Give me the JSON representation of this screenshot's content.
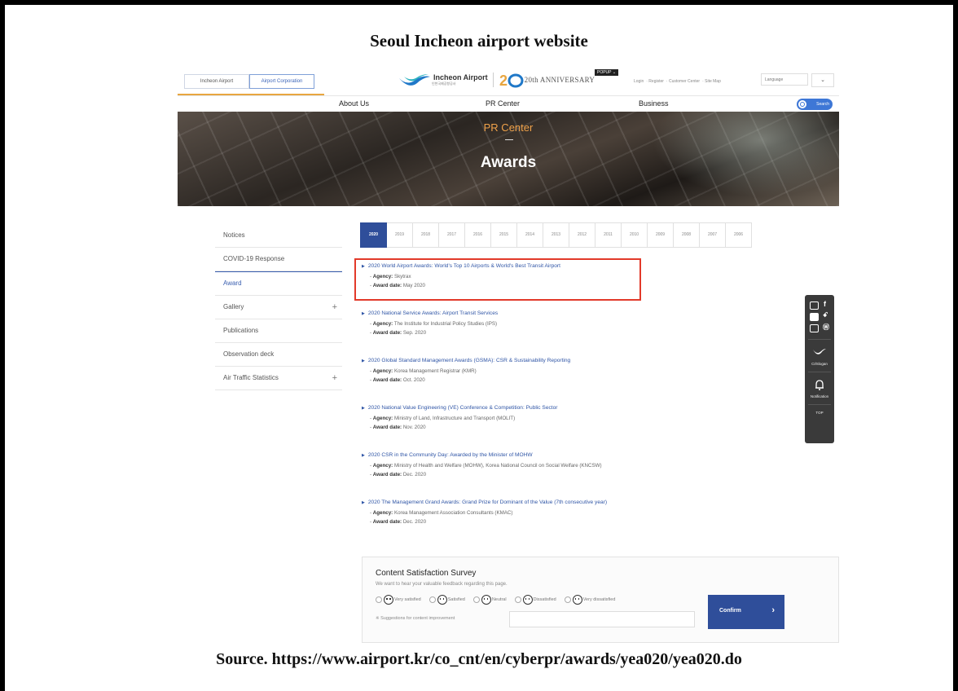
{
  "caption": {
    "title": "Seoul Incheon airport website",
    "source": "Source. https://www.airport.kr/co_cnt/en/cyberpr/awards/yea020/yea020.do"
  },
  "topbar": {
    "tabs": [
      "Incheon Airport",
      "Airport Corporation"
    ],
    "logo_text": "Incheon Airport",
    "logo_sub": "인천국제공항공사",
    "anniversary_text": "20th ANNIVERSARY",
    "popup_label": "POPUP",
    "util_links": [
      "Login",
      "Register",
      "Customer Center",
      "Site Map"
    ],
    "language_label": "Language"
  },
  "gnb": {
    "items": [
      "About Us",
      "PR Center",
      "Business"
    ],
    "search_label": "Search"
  },
  "banner": {
    "subtitle": "PR Center",
    "title": "Awards"
  },
  "lnb": {
    "items": [
      {
        "label": "Notices"
      },
      {
        "label": "COVID-19 Response"
      },
      {
        "label": "Award"
      },
      {
        "label": "Gallery",
        "plus": "+"
      },
      {
        "label": "Publications"
      },
      {
        "label": "Observation deck"
      },
      {
        "label": "Air Traffic Statistics",
        "plus": "+"
      }
    ],
    "active_index": 2
  },
  "years": [
    "2020",
    "2019",
    "2018",
    "2017",
    "2016",
    "2015",
    "2014",
    "2013",
    "2012",
    "2011",
    "2010",
    "2009",
    "2008",
    "2007",
    "2006"
  ],
  "awards": [
    {
      "title": "2020 World Airport Awards: World's Top 10 Airports & World's Best Transit Airport",
      "agency_label": "Agency:",
      "agency": "Skytrax",
      "date_label": "Award date:",
      "date": "May 2020"
    },
    {
      "title": "2020 National Service Awards: Airport Transit Services",
      "agency_label": "Agency:",
      "agency": "The Institute for Industrial Policy Studies (IPS)",
      "date_label": "Award date:",
      "date": "Sep. 2020"
    },
    {
      "title": "2020 Global Standard Management Awards (GSMA): CSR & Sustainability Reporting",
      "agency_label": "Agency:",
      "agency": "Korea Management Registrar (KMR)",
      "date_label": "Award date:",
      "date": "Oct. 2020"
    },
    {
      "title": "2020 National Value Engineering (VE) Conference & Competition: Public Sector",
      "agency_label": "Agency:",
      "agency": "Ministry of Land, Infrastructure and Transport (MOLIT)",
      "date_label": "Award date:",
      "date": "Nov. 2020"
    },
    {
      "title": "2020 CSR in the Community Day: Awarded by the Minister of MOHW",
      "agency_label": "Agency:",
      "agency": "Ministry of Health and Welfare (MOHW), Korea National Council on Social Welfare (KNCSW)",
      "date_label": "Award date:",
      "date": "Dec. 2020"
    },
    {
      "title": "2020 The Management Grand Awards: Grand Prize for Dominant of the Value (7th consecutive year)",
      "agency_label": "Agency:",
      "agency": "Korea Management Association Consultants (KMAC)",
      "date_label": "Award date:",
      "date": "Dec. 2020"
    }
  ],
  "quick": {
    "slogan_label": "CI/Slogan",
    "notification_label": "Notification",
    "top_label": "TOP"
  },
  "survey": {
    "title": "Content Satisfaction Survey",
    "description": "We want to hear your valuable feedback regarding this page.",
    "options": [
      "Very satisfied",
      "Satisfied",
      "Neutral",
      "Dissatisfied",
      "Very dissatisfied"
    ],
    "suggestions_label": "※ Suggestions for content improvement",
    "confirm_label": "Confirm"
  },
  "colors": {
    "accent_blue": "#2f4e9a",
    "link_blue": "#2f55a6",
    "highlight_red": "#e23a2a",
    "banner_orange": "#f0a24a"
  }
}
